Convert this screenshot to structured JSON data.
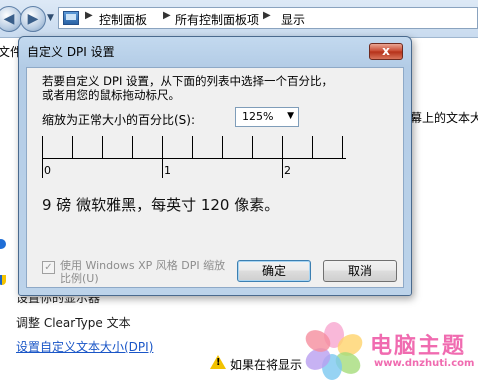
{
  "explorer": {
    "breadcrumbs": [
      "控制面板",
      "所有控制面板项",
      "显示"
    ],
    "left_fragment": "文件",
    "left_links": {
      "partial": "设置你的显示器",
      "cleartype": "调整 ClearType 文本",
      "custom_size": "设置自定义文本大小(DPI)"
    },
    "right_fragment": "幕上的文本大小",
    "warning_text": "如果在将显示"
  },
  "dialog": {
    "title": "自定义 DPI 设置",
    "close_label": "x",
    "description_line1": "若要自定义 DPI 设置，从下面的列表中选择一个百分比，",
    "description_line2": "或者用您的鼠标拖动标尺。",
    "scale_label": "缩放为正常大小的百分比(S):",
    "scale_value": "125%",
    "ruler_labels": [
      "0",
      "1",
      "2"
    ],
    "sample_text": "9 磅 微软雅黑，每英寸 120 像素。",
    "checkbox_label": "使用 Windows XP 风格 DPI 缩放比例(U)",
    "checkbox_checked": true,
    "ok_label": "确定",
    "cancel_label": "取消"
  },
  "watermark": {
    "title": "电脑主题",
    "url": "www.dnzhuti.com"
  }
}
